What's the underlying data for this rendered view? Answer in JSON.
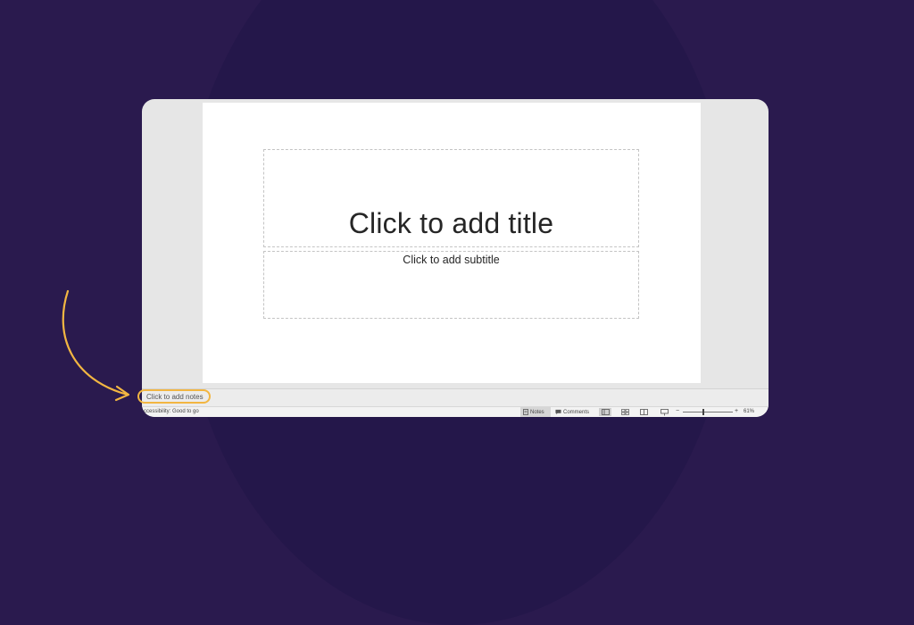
{
  "slide": {
    "title_placeholder": "Click to add title",
    "subtitle_placeholder": "Click to add subtitle"
  },
  "notes": {
    "placeholder": "Click to add notes"
  },
  "status_bar": {
    "accessibility": "ccessibility: Good to go",
    "notes_label": "Notes",
    "comments_label": "Comments",
    "zoom_minus": "−",
    "zoom_plus": "+",
    "zoom_level": "61%"
  },
  "annotation": {
    "highlight_color": "#f2b642"
  },
  "colors": {
    "background": "#2a1a4e",
    "window": "#e6e6e6"
  }
}
